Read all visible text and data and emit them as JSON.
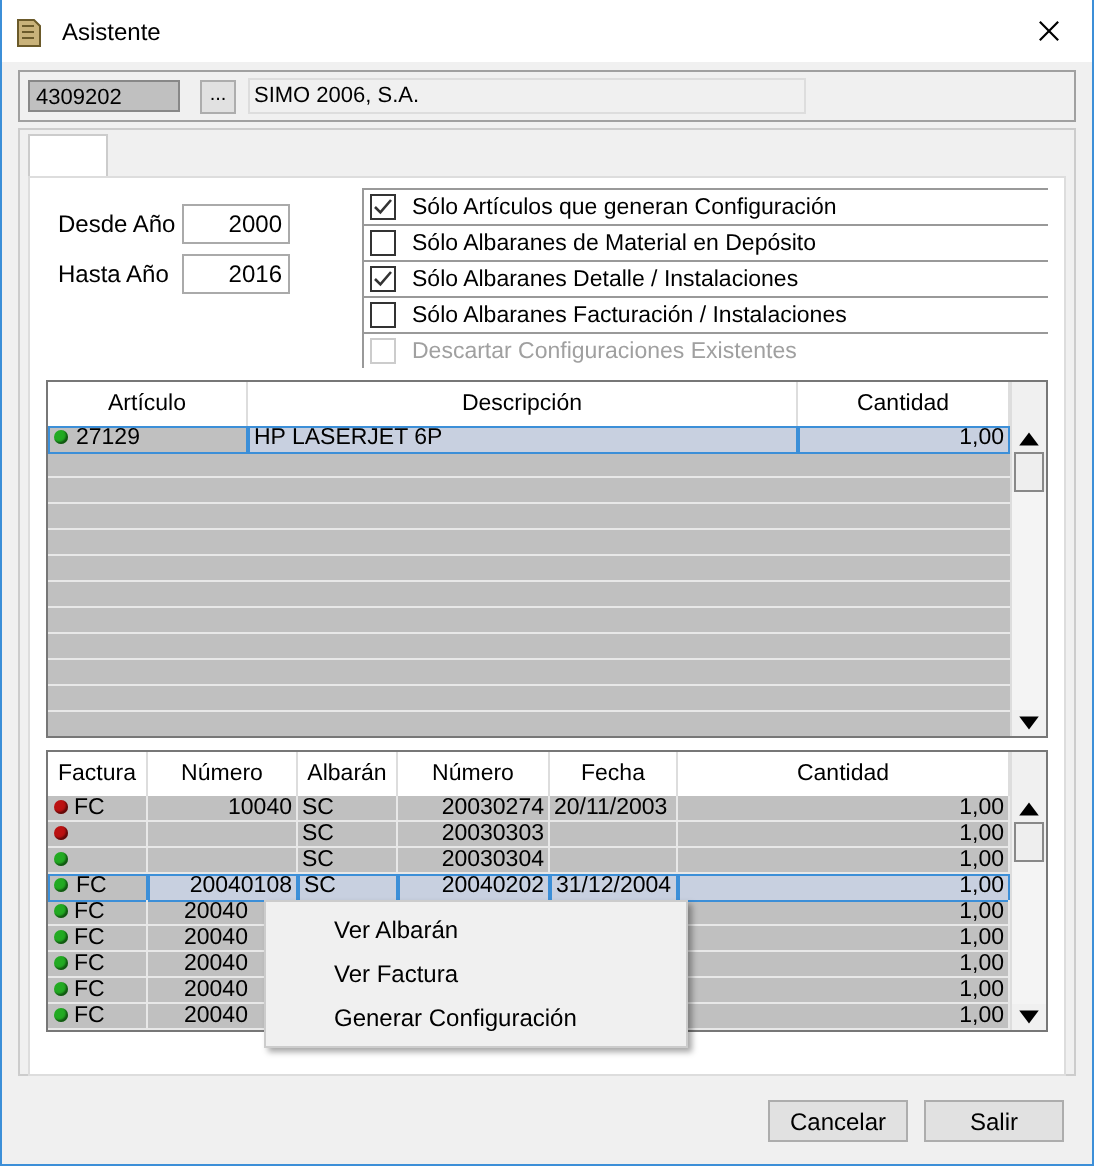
{
  "window": {
    "title": "Asistente"
  },
  "customer": {
    "code": "4309202",
    "lookup": "...",
    "name": "SIMO 2006, S.A."
  },
  "years": [
    {
      "label": "Desde Año",
      "value": "2000"
    },
    {
      "label": "Hasta Año",
      "value": "2016"
    }
  ],
  "options": [
    {
      "label": "Sólo Artículos que generan Configuración",
      "checked": true,
      "disabled": false
    },
    {
      "label": "Sólo Albaranes de Material en Depósito",
      "checked": false,
      "disabled": false
    },
    {
      "label": "Sólo Albaranes Detalle / Instalaciones",
      "checked": true,
      "disabled": false
    },
    {
      "label": "Sólo Albaranes Facturación / Instalaciones",
      "checked": false,
      "disabled": false
    },
    {
      "label": "Descartar Configuraciones Existentes",
      "checked": false,
      "disabled": true
    }
  ],
  "articles": {
    "columns": [
      "Artículo",
      "Descripción",
      "Cantidad"
    ],
    "rows": [
      {
        "color": "#22aa22",
        "selected": true,
        "cells": [
          "27129",
          "HP LASERJET 6P",
          "1,00"
        ]
      }
    ]
  },
  "documents": {
    "columns": [
      "Factura",
      "Número",
      "Albarán",
      "Número",
      "Fecha",
      "Cantidad"
    ],
    "rows": [
      {
        "color": "#bb1111",
        "selected": false,
        "kind": "full",
        "cells": [
          "FC",
          "10040",
          "SC",
          "20030274",
          "20/11/2003",
          "1,00"
        ]
      },
      {
        "color": "#bb1111",
        "selected": false,
        "kind": "full",
        "cells": [
          "",
          "",
          "SC",
          "20030303",
          "",
          "1,00"
        ]
      },
      {
        "color": "#22aa22",
        "selected": false,
        "kind": "full",
        "cells": [
          "",
          "",
          "SC",
          "20030304",
          "",
          "1,00"
        ]
      },
      {
        "color": "#22aa22",
        "selected": true,
        "kind": "full",
        "cells": [
          "FC",
          "20040108",
          "SC",
          "20040202",
          "31/12/2004",
          "1,00"
        ]
      },
      {
        "color": "#22aa22",
        "selected": false,
        "kind": "covered",
        "cells": [
          "FC",
          "20040",
          "",
          "",
          "",
          "1,00"
        ]
      },
      {
        "color": "#22aa22",
        "selected": false,
        "kind": "covered",
        "cells": [
          "FC",
          "20040",
          "",
          "",
          "",
          "1,00"
        ]
      },
      {
        "color": "#22aa22",
        "selected": false,
        "kind": "covered",
        "cells": [
          "FC",
          "20040",
          "",
          "",
          "",
          "1,00"
        ]
      },
      {
        "color": "#22aa22",
        "selected": false,
        "kind": "covered",
        "cells": [
          "FC",
          "20040",
          "",
          "",
          "",
          "1,00"
        ]
      },
      {
        "color": "#22aa22",
        "selected": false,
        "kind": "covered",
        "cells": [
          "FC",
          "20040",
          "",
          "",
          "",
          "1,00"
        ]
      }
    ]
  },
  "context_menu": [
    "Ver Albarán",
    "Ver Factura",
    "Generar Configuración"
  ],
  "buttons": [
    "Cancelar",
    "Salir"
  ]
}
